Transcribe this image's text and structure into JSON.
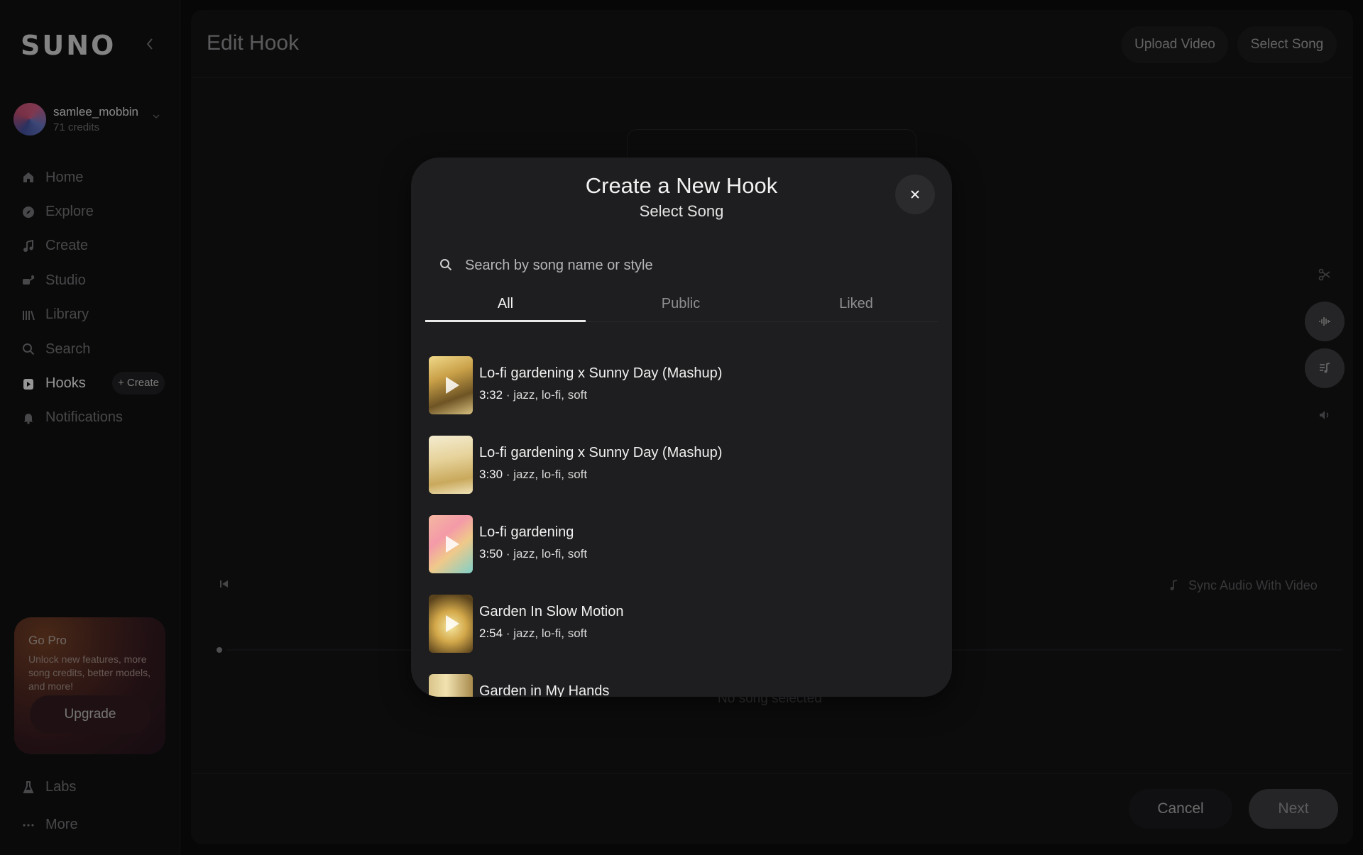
{
  "app": {
    "logo": "SUNO"
  },
  "user": {
    "name": "samlee_mobbin",
    "credits": "71 credits"
  },
  "nav": {
    "items": [
      {
        "label": "Home",
        "icon": "home-icon"
      },
      {
        "label": "Explore",
        "icon": "compass-icon"
      },
      {
        "label": "Create",
        "icon": "music-note-icon"
      },
      {
        "label": "Studio",
        "icon": "studio-icon"
      },
      {
        "label": "Library",
        "icon": "library-icon"
      },
      {
        "label": "Search",
        "icon": "search-icon"
      },
      {
        "label": "Hooks",
        "icon": "hooks-icon",
        "active": true,
        "action": "+ Create"
      },
      {
        "label": "Notifications",
        "icon": "bell-icon"
      }
    ],
    "bottom": [
      {
        "label": "Labs",
        "icon": "flask-icon"
      },
      {
        "label": "More",
        "icon": "ellipsis-icon"
      }
    ]
  },
  "gopro": {
    "title": "Go Pro",
    "description": "Unlock new features, more song credits, better models, and more!",
    "button": "Upgrade"
  },
  "header": {
    "title": "Edit Hook",
    "upload_label": "Upload Video",
    "select_song_label": "Select Song"
  },
  "editor": {
    "sync_label": "Sync Audio With Video",
    "empty_label": "No song selected",
    "cancel_label": "Cancel",
    "next_label": "Next"
  },
  "modal": {
    "title": "Create a New Hook",
    "subtitle": "Select Song",
    "search_placeholder": "Search by song name or style",
    "tabs": [
      {
        "label": "All",
        "active": true
      },
      {
        "label": "Public",
        "active": false
      },
      {
        "label": "Liked",
        "active": false
      }
    ],
    "songs": [
      {
        "title": "Lo-fi gardening x Sunny Day (Mashup)",
        "duration": "3:32",
        "tags": " · jazz, lo-fi, soft"
      },
      {
        "title": "Lo-fi gardening x Sunny Day (Mashup)",
        "duration": "3:30",
        "tags": " · jazz, lo-fi, soft"
      },
      {
        "title": "Lo-fi gardening",
        "duration": "3:50",
        "tags": " · jazz, lo-fi, soft"
      },
      {
        "title": "Garden In Slow Motion",
        "duration": "2:54",
        "tags": " · jazz, lo-fi, soft"
      },
      {
        "title": "Garden in My Hands",
        "duration": "",
        "tags": ""
      }
    ]
  },
  "colors": {
    "background": "#0b0b0c",
    "panel": "#131314",
    "modal": "#1e1e20",
    "accent_text": "#f2f2f2"
  }
}
